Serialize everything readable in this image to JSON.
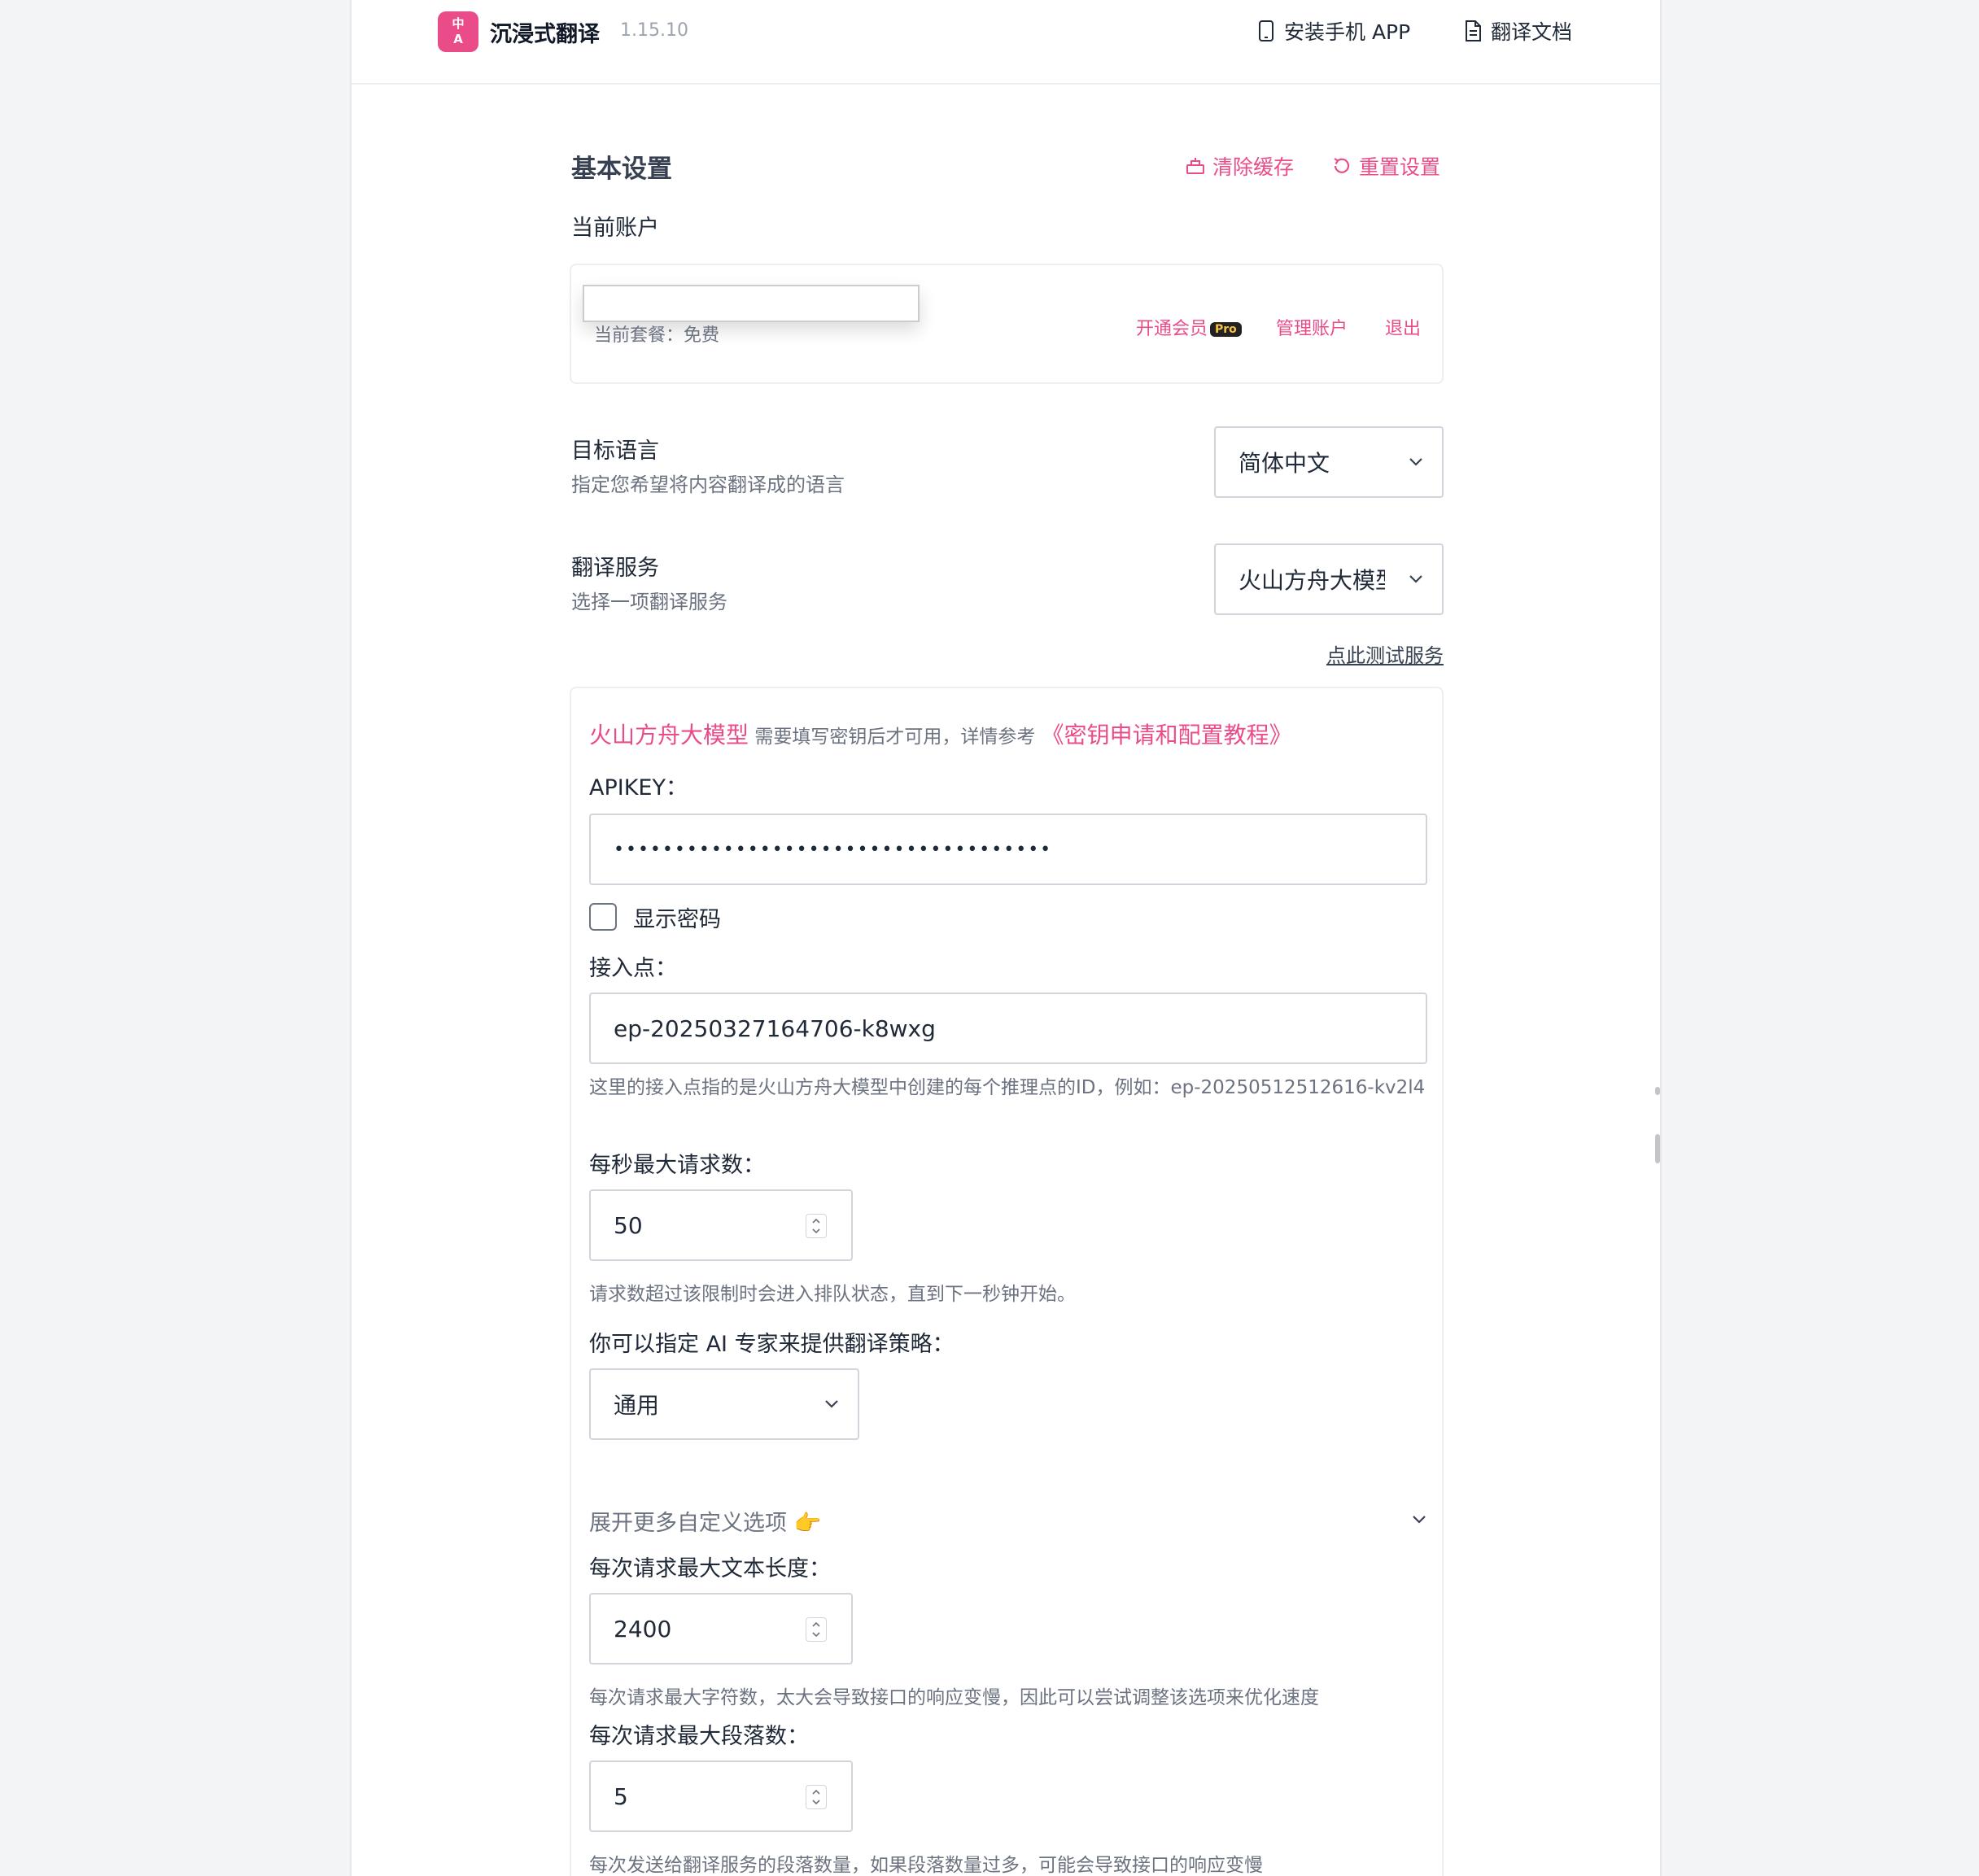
{
  "header": {
    "logo_line1": "中",
    "logo_line2": "A",
    "app_name": "沉浸式翻译",
    "version": "1.15.10",
    "install_app": "安装手机 APP",
    "docs": "翻译文档"
  },
  "basic": {
    "title": "基本设置",
    "clear_cache": "清除缓存",
    "reset": "重置设置",
    "account_label": "当前账户",
    "account_name": "",
    "plan": "当前套餐：免费",
    "upgrade": "开通会员",
    "pro_badge": "Pro",
    "manage": "管理账户",
    "logout": "退出"
  },
  "target_language": {
    "label": "目标语言",
    "description": "指定您希望将内容翻译成的语言",
    "value": "简体中文"
  },
  "translation_service": {
    "label": "翻译服务",
    "description": "选择一项翻译服务",
    "value": "火山方舟大模型",
    "test_link": "点此测试服务"
  },
  "service_config": {
    "name": "火山方舟大模型",
    "tip": " 需要填写密钥后才可用，详情参考 ",
    "tutorial": "《密钥申请和配置教程》",
    "apikey_label": "APIKEY：",
    "apikey_value": "••••••••••••••••••••••••••••••••••••",
    "show_password": "显示密码",
    "endpoint_label": "接入点：",
    "endpoint_value": "ep-20250327164706-k8wxg",
    "endpoint_help": "这里的接入点指的是火山方舟大模型中创建的每个推理点的ID，例如：ep-20250512512616-kv2l4",
    "rps_label": "每秒最大请求数：",
    "rps_value": "50",
    "rps_help": "请求数超过该限制时会进入排队状态，直到下一秒钟开始。",
    "expert_label": "你可以指定 AI 专家来提供翻译策略：",
    "expert_value": "通用",
    "expand_label": "展开更多自定义选项 👉",
    "max_text_label": "每次请求最大文本长度：",
    "max_text_value": "2400",
    "max_text_help": "每次请求最大字符数，太大会导致接口的响应变慢，因此可以尝试调整该选项来优化速度",
    "max_para_label": "每次请求最大段落数：",
    "max_para_value": "5",
    "max_para_help": "每次发送给翻译服务的段落数量，如果段落数量过多，可能会导致接口的响应变慢"
  },
  "colors": {
    "accent": "#ea4c89",
    "text": "#1f2937",
    "muted": "#6b7280",
    "border": "#d1d5db"
  }
}
